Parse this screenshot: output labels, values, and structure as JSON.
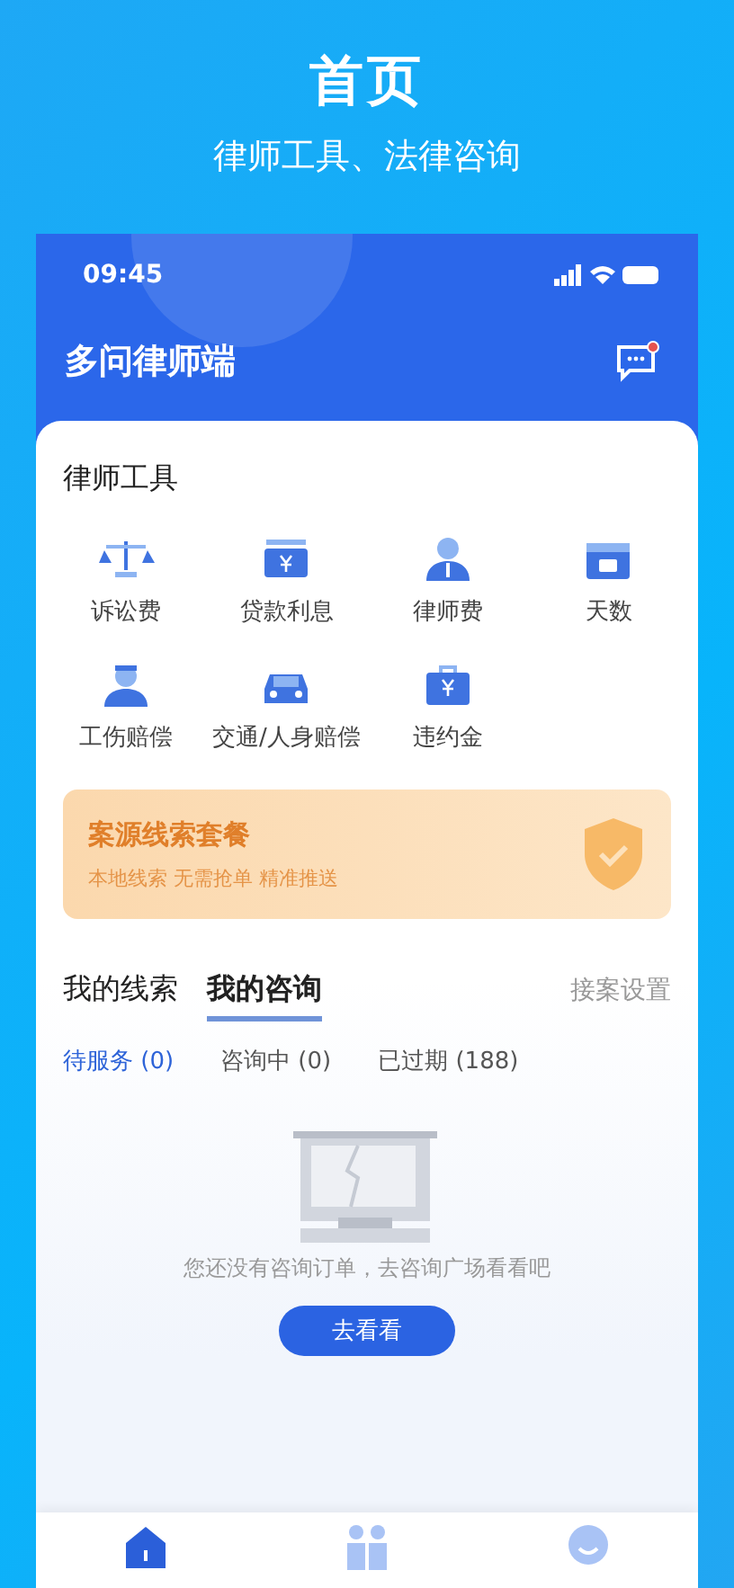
{
  "banner": {
    "title": "首页",
    "subtitle": "律师工具、法律咨询"
  },
  "status_bar": {
    "time": "09:45"
  },
  "header": {
    "title": "多问律师端",
    "has_notification": true
  },
  "tools": {
    "title": "律师工具",
    "items": [
      {
        "label": "诉讼费"
      },
      {
        "label": "贷款利息"
      },
      {
        "label": "律师费"
      },
      {
        "label": "天数"
      },
      {
        "label": "工伤赔偿"
      },
      {
        "label": "交通/人身赔偿"
      },
      {
        "label": "违约金"
      }
    ]
  },
  "promo": {
    "title": "案源线索套餐",
    "subtitle": "本地线索 无需抢单 精准推送"
  },
  "tabs": [
    {
      "label": "我的线索",
      "selected": false
    },
    {
      "label": "我的咨询",
      "selected": true
    }
  ],
  "tab_action": "接案设置",
  "subtabs": [
    {
      "label": "待服务 (0)",
      "selected": true
    },
    {
      "label": "咨询中 (0)",
      "selected": false
    },
    {
      "label": "已过期 (188)",
      "selected": false
    }
  ],
  "empty": {
    "message": "您还没有咨询订单，去咨询广场看看吧",
    "button": "去看看"
  },
  "nav": [
    {
      "selected": true
    },
    {
      "selected": false
    },
    {
      "selected": false
    }
  ]
}
